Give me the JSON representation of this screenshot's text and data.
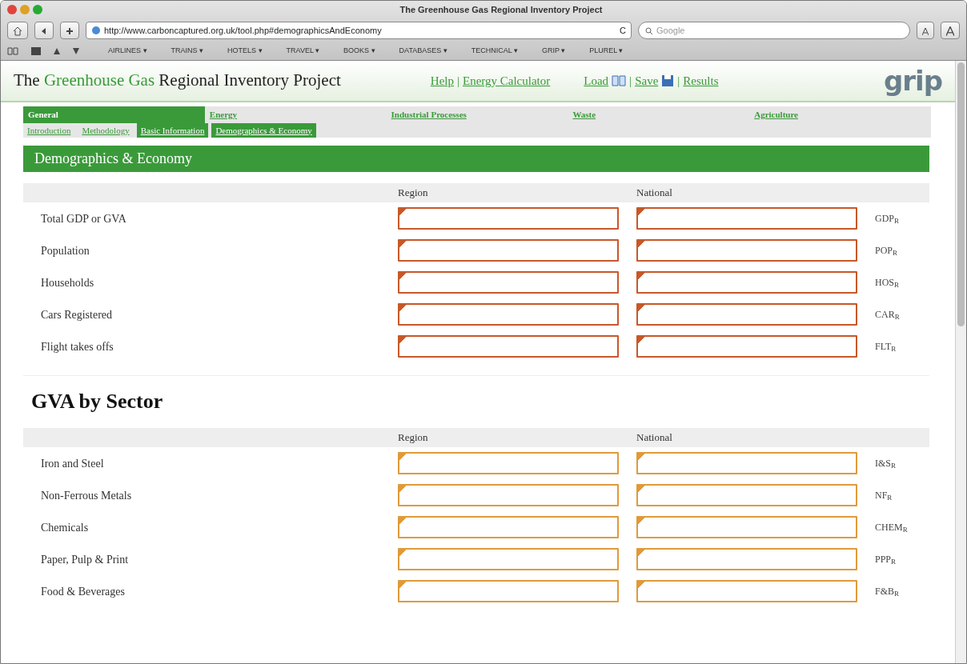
{
  "window": {
    "title": "The Greenhouse Gas Regional Inventory Project"
  },
  "toolbar": {
    "url": "http://www.carboncaptured.org.uk/tool.php#demographicsAndEconomy",
    "reload": "C",
    "search_placeholder": "Google"
  },
  "bookmarks": [
    "AIRLINES ▾",
    "TRAINS ▾",
    "HOTELS ▾",
    "TRAVEL ▾",
    "BOOKS ▾",
    "DATABASES ▾",
    "TECHNICAL ▾",
    "GRIP ▾",
    "PLUREL ▾"
  ],
  "site": {
    "title_parts": [
      {
        "text": "The ",
        "kind": "plain"
      },
      {
        "text": "Greenhouse Gas",
        "kind": "accent"
      },
      {
        "text": " Regional Inventory Project",
        "kind": "plain"
      }
    ],
    "links": [
      {
        "text": "Help"
      },
      {
        "text": "Energy Calculator"
      }
    ],
    "separators": [
      "|",
      "|",
      "|"
    ],
    "actions": [
      {
        "text": "Load",
        "kind": "book"
      },
      {
        "text": "Save",
        "kind": "disk"
      },
      {
        "text": "Results",
        "kind": "plain"
      }
    ],
    "logo": "grip"
  },
  "main_tabs": [
    {
      "label": "General",
      "selected": true
    },
    {
      "label": "Energy",
      "selected": false
    },
    {
      "label": "Industrial Processes",
      "selected": false
    },
    {
      "label": "Waste",
      "selected": false
    },
    {
      "label": "Agriculture",
      "selected": false
    }
  ],
  "sub_tabs": [
    {
      "label": "Introduction",
      "selected": false
    },
    {
      "label": "Methodology",
      "selected": false
    },
    {
      "label": "Basic Information",
      "selected": true
    },
    {
      "label": "Demographics & Economy",
      "selected": true
    }
  ],
  "banner": "Demographics & Economy",
  "sections": [
    {
      "color": "#c8582a",
      "columns": [
        "Region",
        "National"
      ],
      "rows": [
        {
          "label": "Total GDP or GVA",
          "code": "GDP$_{R}$"
        },
        {
          "label": "Population",
          "code": "POP$_{R}$"
        },
        {
          "label": "Households",
          "code": "HOS$_{R}$"
        },
        {
          "label": "Cars Registered",
          "code": "CAR$_{R}$"
        },
        {
          "label": "Flight takes offs",
          "code": "FLT$_{R}$"
        }
      ]
    },
    {
      "heading": "GVA by Sector",
      "color": "#e09a3a",
      "columns": [
        "Region",
        "National"
      ],
      "rows": [
        {
          "label": "Iron and Steel",
          "code": "I&S$_{R}$"
        },
        {
          "label": "Non-Ferrous Metals",
          "code": "NF$_{R}$"
        },
        {
          "label": "Chemicals",
          "code": "CHEM$_{R}$"
        },
        {
          "label": "Paper, Pulp & Print",
          "code": "PPP$_{R}$"
        },
        {
          "label": "Food & Beverages",
          "code": "F&B$_{R}$"
        }
      ]
    }
  ]
}
